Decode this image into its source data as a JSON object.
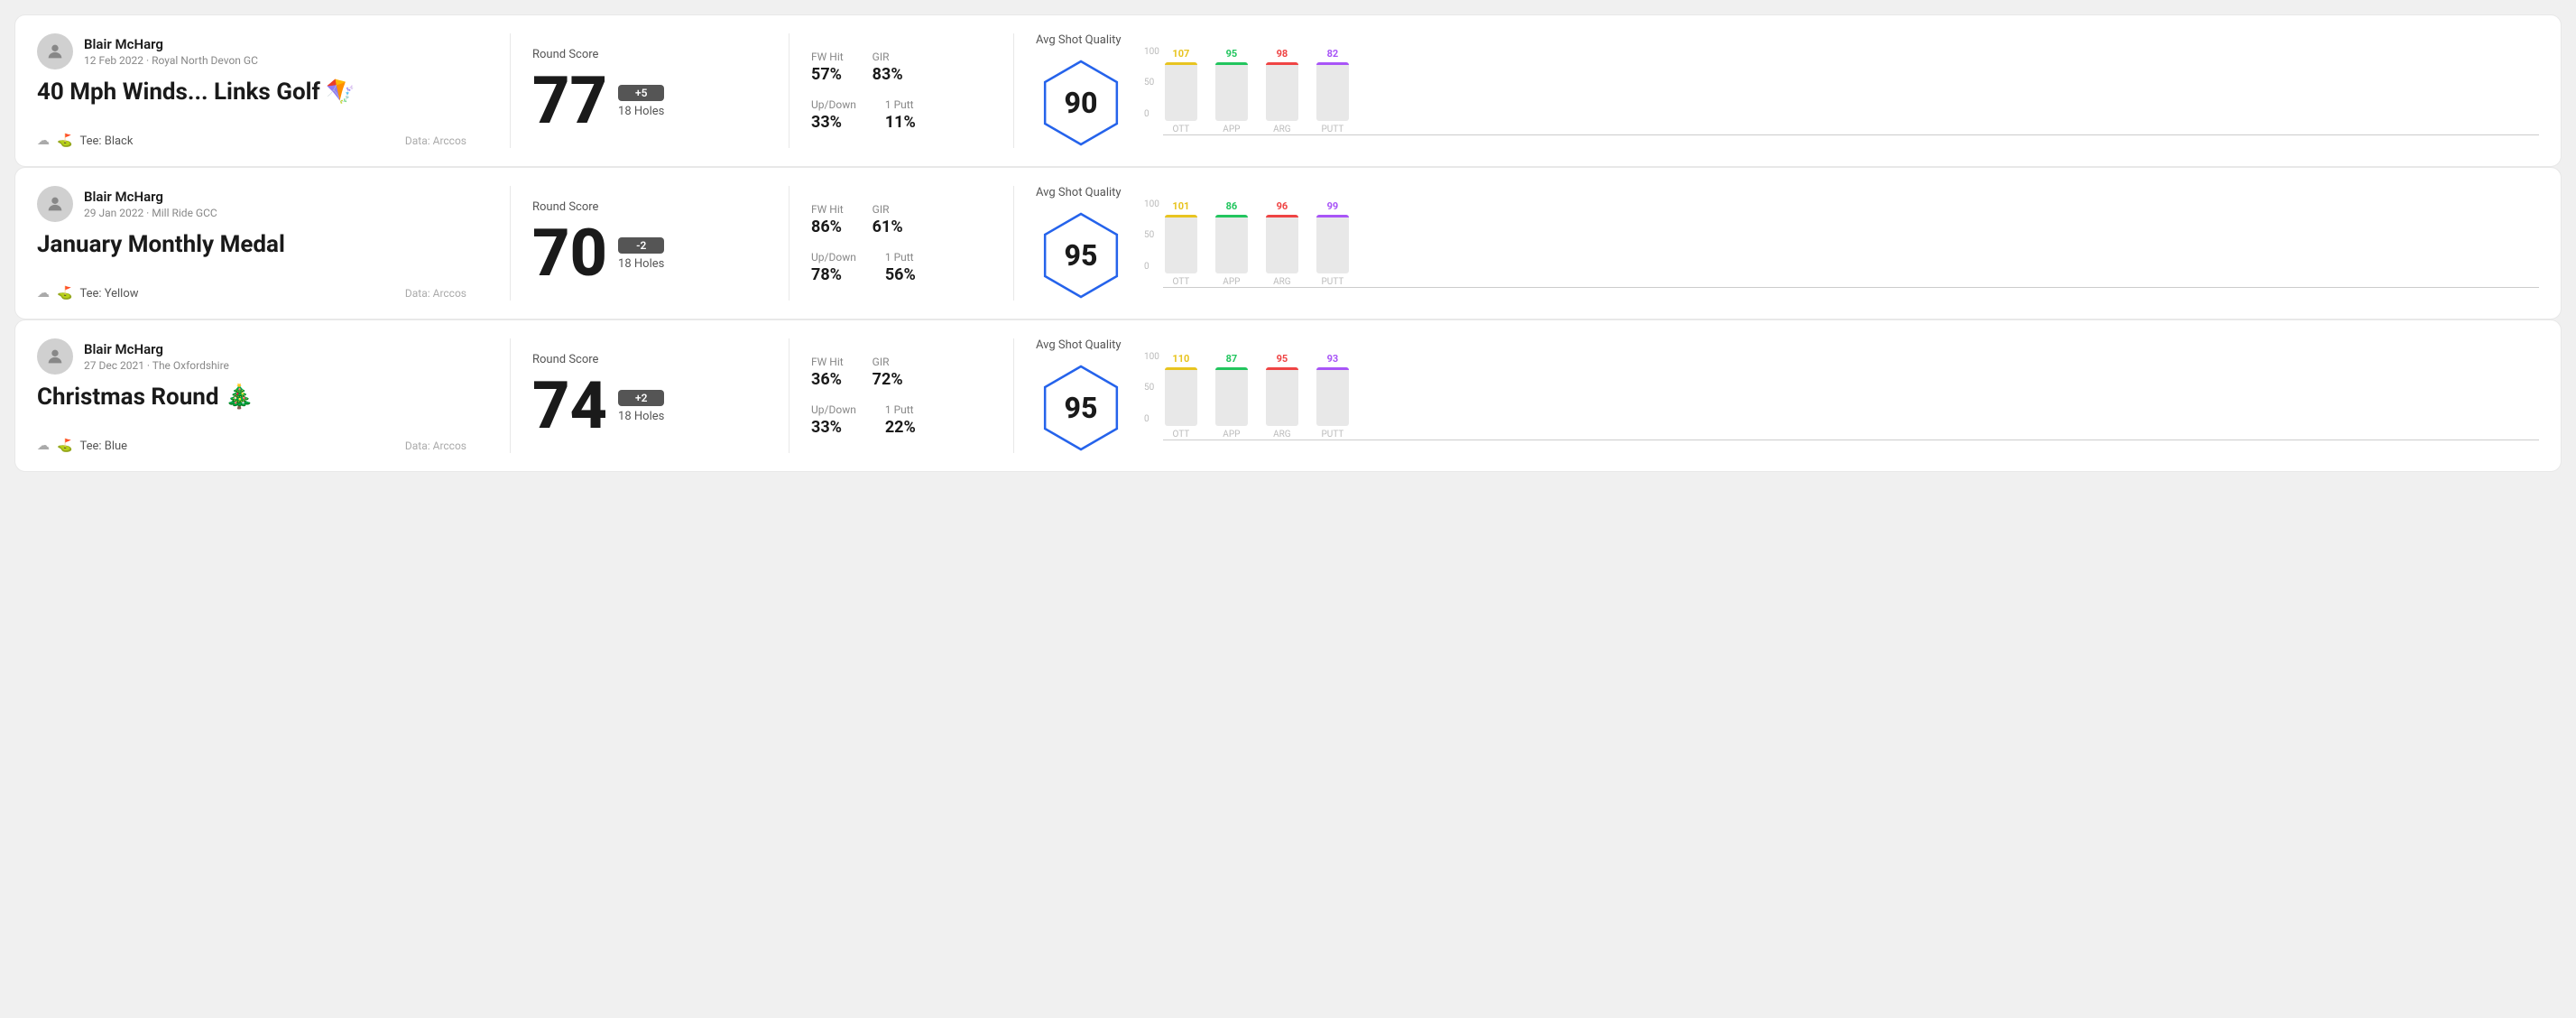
{
  "cards": [
    {
      "id": "card-1",
      "player": "Blair McHarg",
      "date": "12 Feb 2022 · Royal North Devon GC",
      "title": "40 Mph Winds... Links Golf 🪁",
      "tee": "Black",
      "dataSource": "Data: Arccos",
      "roundScoreLabel": "Round Score",
      "score": "77",
      "scoreBadge": "+5",
      "holes": "18 Holes",
      "fwHitLabel": "FW Hit",
      "fwHitValue": "57%",
      "girLabel": "GIR",
      "girValue": "83%",
      "upDownLabel": "Up/Down",
      "upDownValue": "33%",
      "onePuttLabel": "1 Putt",
      "onePuttValue": "11%",
      "avgShotQualityLabel": "Avg Shot Quality",
      "shotQualityScore": "90",
      "chart": {
        "bars": [
          {
            "label": "OTT",
            "value": 107,
            "color": "#e8c420",
            "pct": 78
          },
          {
            "label": "APP",
            "value": 95,
            "color": "#22c55e",
            "pct": 68
          },
          {
            "label": "ARG",
            "value": 98,
            "color": "#ef4444",
            "pct": 72
          },
          {
            "label": "PUTT",
            "value": 82,
            "color": "#a855f7",
            "pct": 58
          }
        ],
        "yLabels": [
          "100",
          "50",
          "0"
        ]
      }
    },
    {
      "id": "card-2",
      "player": "Blair McHarg",
      "date": "29 Jan 2022 · Mill Ride GCC",
      "title": "January Monthly Medal",
      "tee": "Yellow",
      "dataSource": "Data: Arccos",
      "roundScoreLabel": "Round Score",
      "score": "70",
      "scoreBadge": "-2",
      "holes": "18 Holes",
      "fwHitLabel": "FW Hit",
      "fwHitValue": "86%",
      "girLabel": "GIR",
      "girValue": "61%",
      "upDownLabel": "Up/Down",
      "upDownValue": "78%",
      "onePuttLabel": "1 Putt",
      "onePuttValue": "56%",
      "avgShotQualityLabel": "Avg Shot Quality",
      "shotQualityScore": "95",
      "chart": {
        "bars": [
          {
            "label": "OTT",
            "value": 101,
            "color": "#e8c420",
            "pct": 75
          },
          {
            "label": "APP",
            "value": 86,
            "color": "#22c55e",
            "pct": 62
          },
          {
            "label": "ARG",
            "value": 96,
            "color": "#ef4444",
            "pct": 71
          },
          {
            "label": "PUTT",
            "value": 99,
            "color": "#a855f7",
            "pct": 73
          }
        ],
        "yLabels": [
          "100",
          "50",
          "0"
        ]
      }
    },
    {
      "id": "card-3",
      "player": "Blair McHarg",
      "date": "27 Dec 2021 · The Oxfordshire",
      "title": "Christmas Round 🎄",
      "tee": "Blue",
      "dataSource": "Data: Arccos",
      "roundScoreLabel": "Round Score",
      "score": "74",
      "scoreBadge": "+2",
      "holes": "18 Holes",
      "fwHitLabel": "FW Hit",
      "fwHitValue": "36%",
      "girLabel": "GIR",
      "girValue": "72%",
      "upDownLabel": "Up/Down",
      "upDownValue": "33%",
      "onePuttLabel": "1 Putt",
      "onePuttValue": "22%",
      "avgShotQualityLabel": "Avg Shot Quality",
      "shotQualityScore": "95",
      "chart": {
        "bars": [
          {
            "label": "OTT",
            "value": 110,
            "color": "#e8c420",
            "pct": 82
          },
          {
            "label": "APP",
            "value": 87,
            "color": "#22c55e",
            "pct": 63
          },
          {
            "label": "ARG",
            "value": 95,
            "color": "#ef4444",
            "pct": 70
          },
          {
            "label": "PUTT",
            "value": 93,
            "color": "#a855f7",
            "pct": 68
          }
        ],
        "yLabels": [
          "100",
          "50",
          "0"
        ]
      }
    }
  ]
}
